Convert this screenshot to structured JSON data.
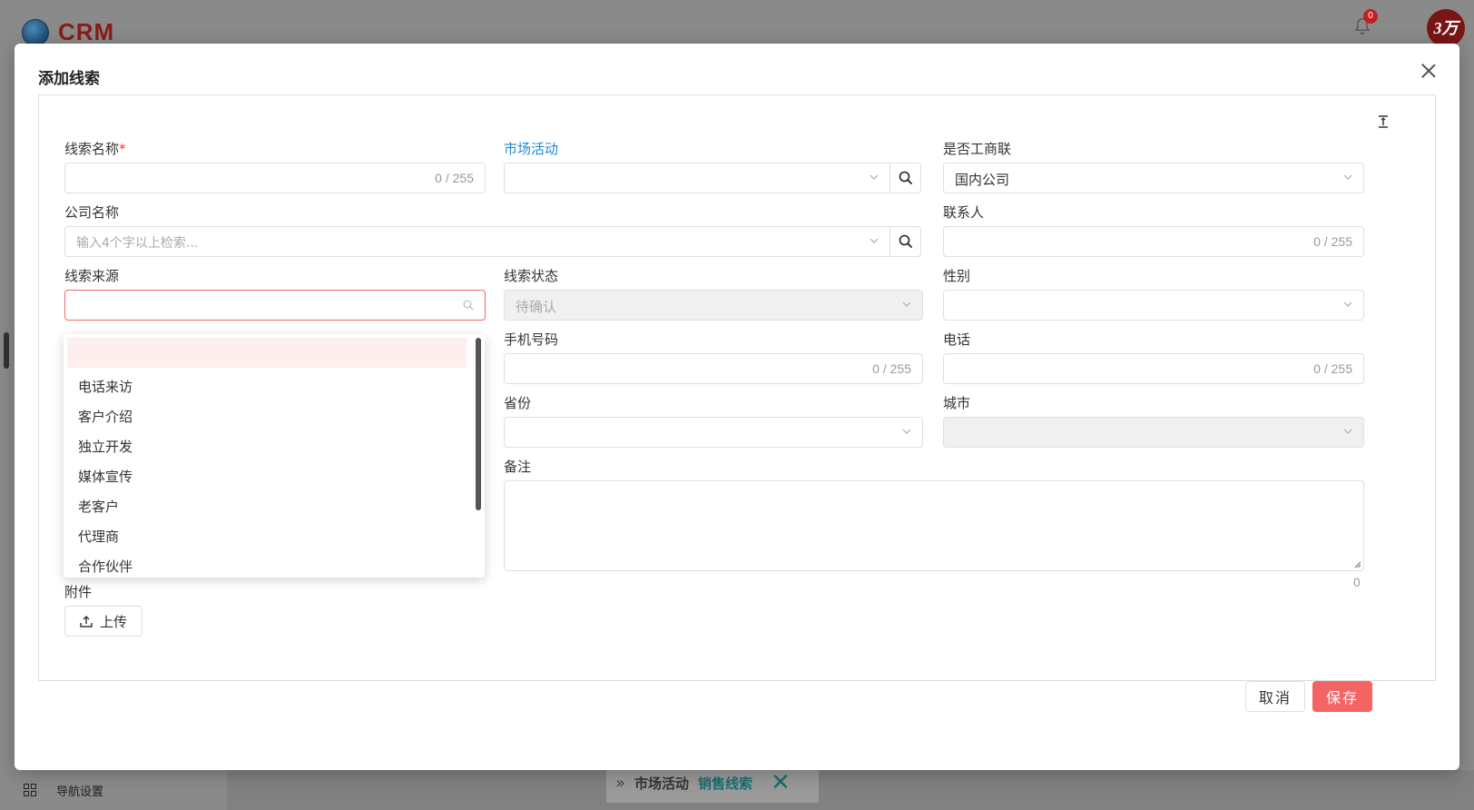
{
  "app": {
    "logo_text": "CRM",
    "notification_count": "0",
    "avatar_text": "3万"
  },
  "background": {
    "nav_settings_label": "导航设置",
    "tabs": [
      "市场活动",
      "销售线索"
    ]
  },
  "modal": {
    "title": "添加线索",
    "fields": {
      "lead_name": {
        "label": "线索名称",
        "required_mark": "*",
        "counter": "0 / 255"
      },
      "campaign": {
        "label": "市场活动"
      },
      "ic_linked": {
        "label": "是否工商联",
        "value": "国内公司"
      },
      "company_name": {
        "label": "公司名称",
        "placeholder": "输入4个字以上检索..."
      },
      "contact": {
        "label": "联系人",
        "counter": "0 / 255"
      },
      "lead_source": {
        "label": "线索来源"
      },
      "lead_status": {
        "label": "线索状态",
        "value": "待确认"
      },
      "gender": {
        "label": "性别"
      },
      "mobile": {
        "label": "手机号码",
        "counter": "0 / 255"
      },
      "phone": {
        "label": "电话",
        "counter": "0 / 255"
      },
      "province": {
        "label": "省份"
      },
      "city": {
        "label": "城市"
      },
      "notes": {
        "label": "备注",
        "counter": "0"
      },
      "attachment": {
        "label": "附件",
        "upload_label": "上传"
      }
    },
    "lead_source_options": [
      "",
      "电话来访",
      "客户介绍",
      "独立开发",
      "媒体宣传",
      "老客户",
      "代理商",
      "合作伙伴"
    ],
    "buttons": {
      "cancel": "取消",
      "save": "保存"
    }
  },
  "colors": {
    "accent": "#f56464",
    "link": "#1a8ad6",
    "required": "#e53935"
  }
}
